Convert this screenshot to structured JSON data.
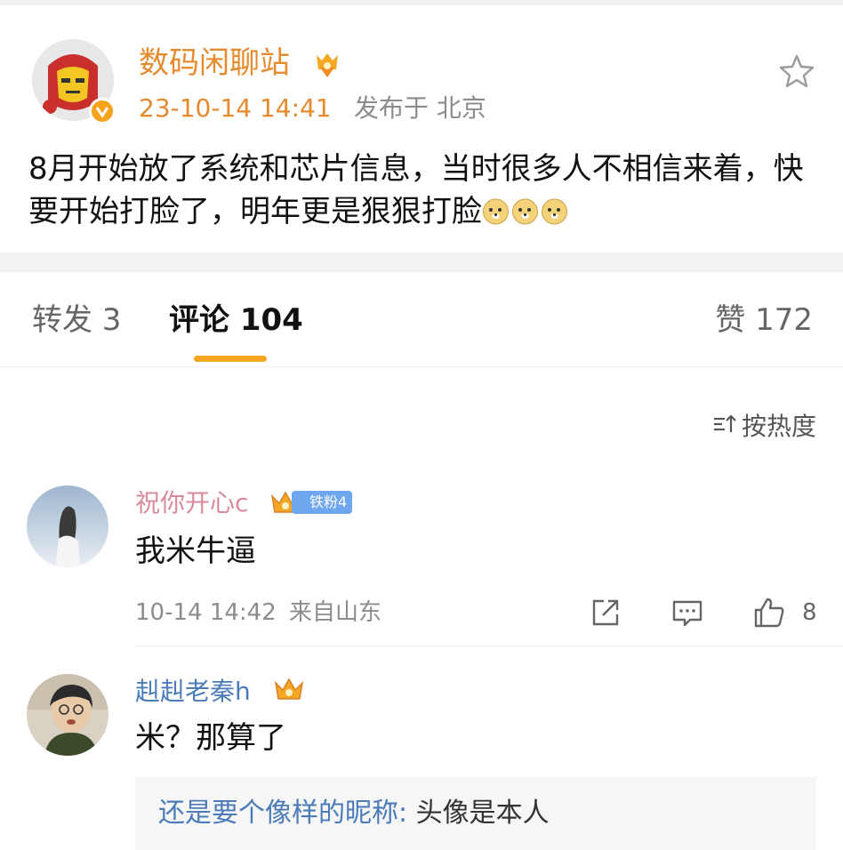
{
  "post": {
    "author": "数码闲聊站",
    "time": "23-10-14 14:41",
    "location": "发布于 北京",
    "text": "8月开始放了系统和芯片信息，当时很多人不相信来着，快要开始打脸了，明年更是狠狠打脸",
    "emoji_count": 3
  },
  "tabs": {
    "repost": "转发 3",
    "comments": "评论 104",
    "likes": "赞 172"
  },
  "sort": {
    "label": "按热度"
  },
  "comments": [
    {
      "user": "祝你开心c",
      "fan_badge": "铁粉4",
      "text": "我米牛逼",
      "time": "10-14 14:42",
      "location": "来自山东",
      "likes": "8"
    },
    {
      "user": "赳赳老秦h",
      "text": "米？那算了",
      "reply": {
        "user": "还是要个像样的昵称:",
        "text": "头像是本人"
      }
    }
  ],
  "colors": {
    "accent": "#f5a623",
    "author_orange": "#e68a2e",
    "link_blue": "#4b7bb8",
    "pink_name": "#d98a9b",
    "blue_name": "#4b7bb8"
  },
  "icons": [
    "vip-badge-icon",
    "medal-icon",
    "star-icon",
    "sort-icon",
    "crown-icon",
    "share-icon",
    "comment-icon",
    "like-icon",
    "doge-emoji-icon"
  ]
}
